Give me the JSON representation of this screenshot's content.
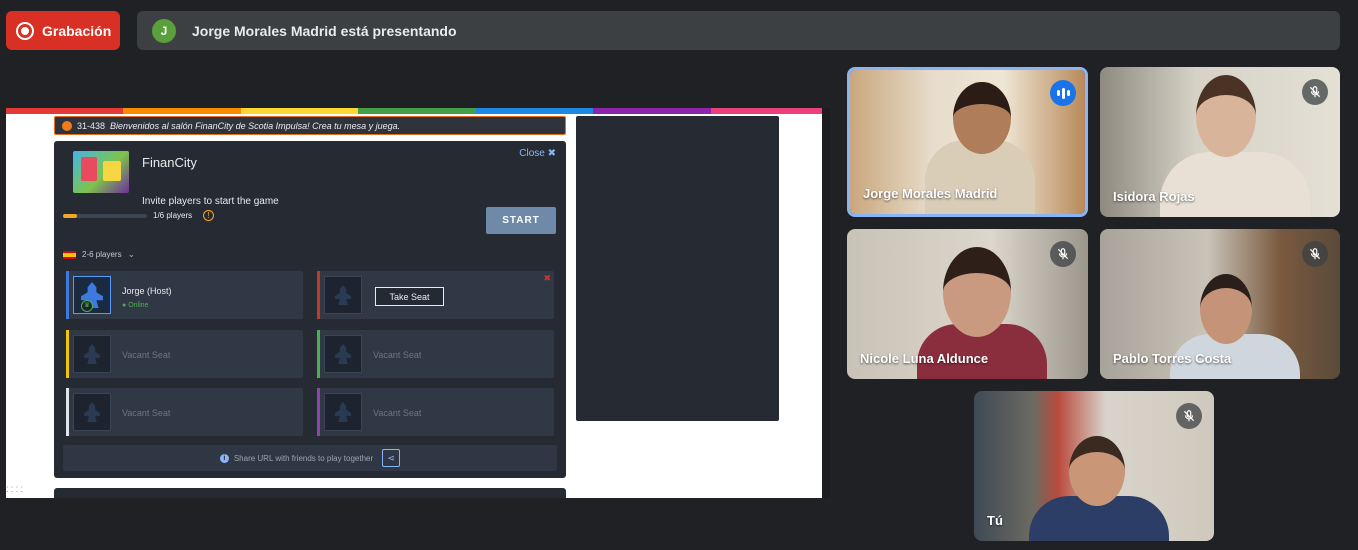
{
  "recording": {
    "label": "Grabación"
  },
  "presenter": {
    "initial": "J",
    "text": "Jorge Morales Madrid está presentando"
  },
  "shared_screen": {
    "announcement": {
      "room": "31-438",
      "text": "Bienvenidos al salón FinanCity de Scotia Impulsa! Crea tu mesa y juega."
    },
    "game": {
      "name": "FinanCity",
      "close_label": "Close",
      "invite_text": "Invite players to start the game",
      "players_count": "1/6 players",
      "players_progress": 0.17,
      "start_label": "START",
      "player_range": "2-6 players",
      "seats": [
        {
          "label": "Jorge (Host)",
          "status": "Online",
          "color": "#3d7ae0"
        },
        {
          "label": "Take Seat",
          "color": "#c0392b"
        },
        {
          "label": "Vacant Seat",
          "color": "#f1c40f"
        },
        {
          "label": "Vacant Seat",
          "color": "#4caf50"
        },
        {
          "label": "Vacant Seat",
          "color": "#dfe6ee"
        },
        {
          "label": "Vacant Seat",
          "color": "#8e44ad"
        }
      ],
      "share_text": "Share URL with friends to play together"
    }
  },
  "participants": [
    {
      "name": "Jorge Morales Madrid",
      "speaking": true
    },
    {
      "name": "Isidora Rojas",
      "muted": true
    },
    {
      "name": "Nicole Luna Aldunce",
      "muted": true
    },
    {
      "name": "Pablo Torres Costa",
      "muted": true
    },
    {
      "name": "Tú",
      "muted": true
    }
  ]
}
